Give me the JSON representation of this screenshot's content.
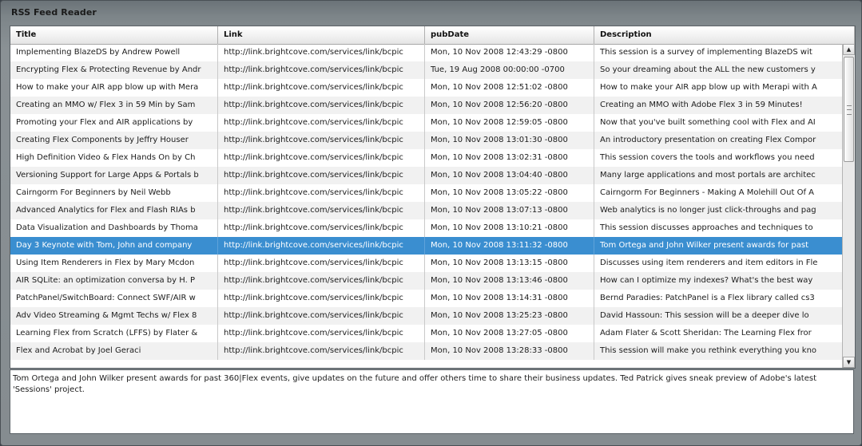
{
  "window": {
    "title": "RSS Feed Reader"
  },
  "grid": {
    "columns": [
      "Title",
      "Link",
      "pubDate",
      "Description"
    ],
    "selected_index": 11,
    "rows": [
      [
        "Implementing BlazeDS by Andrew Powell",
        "http://link.brightcove.com/services/link/bcpic",
        "Mon, 10 Nov 2008 12:43:29 -0800",
        "This session is a survey of implementing BlazeDS wit"
      ],
      [
        "Encrypting Flex & Protecting Revenue by Andr",
        "http://link.brightcove.com/services/link/bcpic",
        "Tue, 19 Aug 2008 00:00:00 -0700",
        "So your dreaming about the ALL the new customers y"
      ],
      [
        "How to make your AIR app blow up with Mera",
        "http://link.brightcove.com/services/link/bcpic",
        "Mon, 10 Nov 2008 12:51:02 -0800",
        "How to make your AIR app blow up with Merapi with A"
      ],
      [
        "Creating an MMO w/ Flex 3 in 59 Min by Sam",
        "http://link.brightcove.com/services/link/bcpic",
        "Mon, 10 Nov 2008 12:56:20 -0800",
        "Creating an MMO with Adobe Flex 3 in 59 Minutes!"
      ],
      [
        "Promoting your Flex and AIR applications by",
        "http://link.brightcove.com/services/link/bcpic",
        "Mon, 10 Nov 2008 12:59:05 -0800",
        "Now that you've built something cool with Flex and AI"
      ],
      [
        "Creating Flex Components by Jeffry Houser",
        "http://link.brightcove.com/services/link/bcpic",
        "Mon, 10 Nov 2008 13:01:30 -0800",
        "An introductory presentation on creating Flex Compor"
      ],
      [
        "High Definition Video & Flex Hands On by Ch",
        "http://link.brightcove.com/services/link/bcpic",
        "Mon, 10 Nov 2008 13:02:31 -0800",
        "This session covers the tools and workflows you need"
      ],
      [
        "Versioning Support for Large Apps & Portals b",
        "http://link.brightcove.com/services/link/bcpic",
        "Mon, 10 Nov 2008 13:04:40 -0800",
        "Many large applications and most portals are architec"
      ],
      [
        "Cairngorm For Beginners by Neil Webb",
        "http://link.brightcove.com/services/link/bcpic",
        "Mon, 10 Nov 2008 13:05:22 -0800",
        "Cairngorm For Beginners - Making A Molehill Out Of A"
      ],
      [
        "Advanced Analytics for Flex and Flash RIAs b",
        "http://link.brightcove.com/services/link/bcpic",
        "Mon, 10 Nov 2008 13:07:13 -0800",
        "Web analytics is no longer just click-throughs and pag"
      ],
      [
        "Data Visualization and Dashboards by Thoma",
        "http://link.brightcove.com/services/link/bcpic",
        "Mon, 10 Nov 2008 13:10:21 -0800",
        "This session discusses approaches and techniques to"
      ],
      [
        "Day 3 Keynote with Tom, John and company",
        "http://link.brightcove.com/services/link/bcpic",
        "Mon, 10 Nov 2008 13:11:32 -0800",
        "Tom Ortega and John Wilker present awards for past"
      ],
      [
        "Using Item Renderers in Flex by Mary Mcdon",
        "http://link.brightcove.com/services/link/bcpic",
        "Mon, 10 Nov 2008 13:13:15 -0800",
        "Discusses using item renderers and item editors in Fle"
      ],
      [
        "AIR SQLite: an optimization conversa by H. P",
        "http://link.brightcove.com/services/link/bcpic",
        "Mon, 10 Nov 2008 13:13:46 -0800",
        "How can I optimize my indexes? What's the best way"
      ],
      [
        "PatchPanel/SwitchBoard: Connect SWF/AIR w",
        "http://link.brightcove.com/services/link/bcpic",
        "Mon, 10 Nov 2008 13:14:31 -0800",
        "Bernd Paradies: PatchPanel is a Flex library called cs3"
      ],
      [
        "Adv Video Streaming & Mgmt Techs w/ Flex 8",
        "http://link.brightcove.com/services/link/bcpic",
        "Mon, 10 Nov 2008 13:25:23 -0800",
        "David Hassoun:  This session will be a deeper dive lo"
      ],
      [
        "Learning Flex from Scratch (LFFS) by Flater &",
        "http://link.brightcove.com/services/link/bcpic",
        "Mon, 10 Nov 2008 13:27:05 -0800",
        "Adam Flater & Scott Sheridan:  The Learning Flex fror"
      ],
      [
        "Flex and Acrobat by Joel Geraci",
        "http://link.brightcove.com/services/link/bcpic",
        "Mon, 10 Nov 2008 13:28:33 -0800",
        "This session will make you rethink everything you kno"
      ]
    ]
  },
  "scrollbar": {
    "up_icon": "arrow-up-icon",
    "down_icon": "arrow-down-icon"
  },
  "detail": {
    "text": "Tom Ortega and John Wilker present awards for past 360|Flex events, give updates on the future and offer others time to share their business updates.  Ted Patrick gives sneak preview of Adobe's latest 'Sessions' project."
  }
}
